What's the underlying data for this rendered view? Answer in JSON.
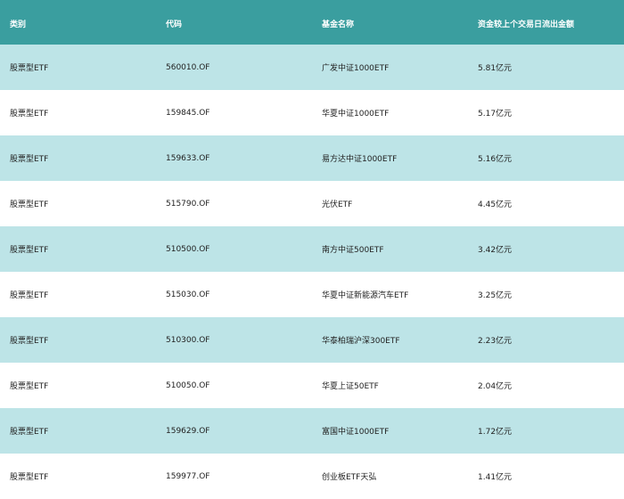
{
  "table": {
    "headers": [
      "类别",
      "代码",
      "基金名称",
      "资金较上个交易日流出金额"
    ],
    "rows": [
      [
        "股票型ETF",
        "560010.OF",
        "广发中证1000ETF",
        "5.81亿元"
      ],
      [
        "股票型ETF",
        "159845.OF",
        "华夏中证1000ETF",
        "5.17亿元"
      ],
      [
        "股票型ETF",
        "159633.OF",
        "易方达中证1000ETF",
        "5.16亿元"
      ],
      [
        "股票型ETF",
        "515790.OF",
        "光伏ETF",
        "4.45亿元"
      ],
      [
        "股票型ETF",
        "510500.OF",
        "南方中证500ETF",
        "3.42亿元"
      ],
      [
        "股票型ETF",
        "515030.OF",
        "华夏中证新能源汽车ETF",
        "3.25亿元"
      ],
      [
        "股票型ETF",
        "510300.OF",
        "华泰柏瑞沪深300ETF",
        "2.23亿元"
      ],
      [
        "股票型ETF",
        "510050.OF",
        "华夏上证50ETF",
        "2.04亿元"
      ],
      [
        "股票型ETF",
        "159629.OF",
        "富国中证1000ETF",
        "1.72亿元"
      ],
      [
        "股票型ETF",
        "159977.OF",
        "创业板ETF天弘",
        "1.41亿元"
      ]
    ]
  },
  "colors": {
    "header_bg": "#3a9e9f",
    "header_text": "#ffffff",
    "row_alt_bg": "#bde4e7",
    "row_bg": "#ffffff"
  }
}
